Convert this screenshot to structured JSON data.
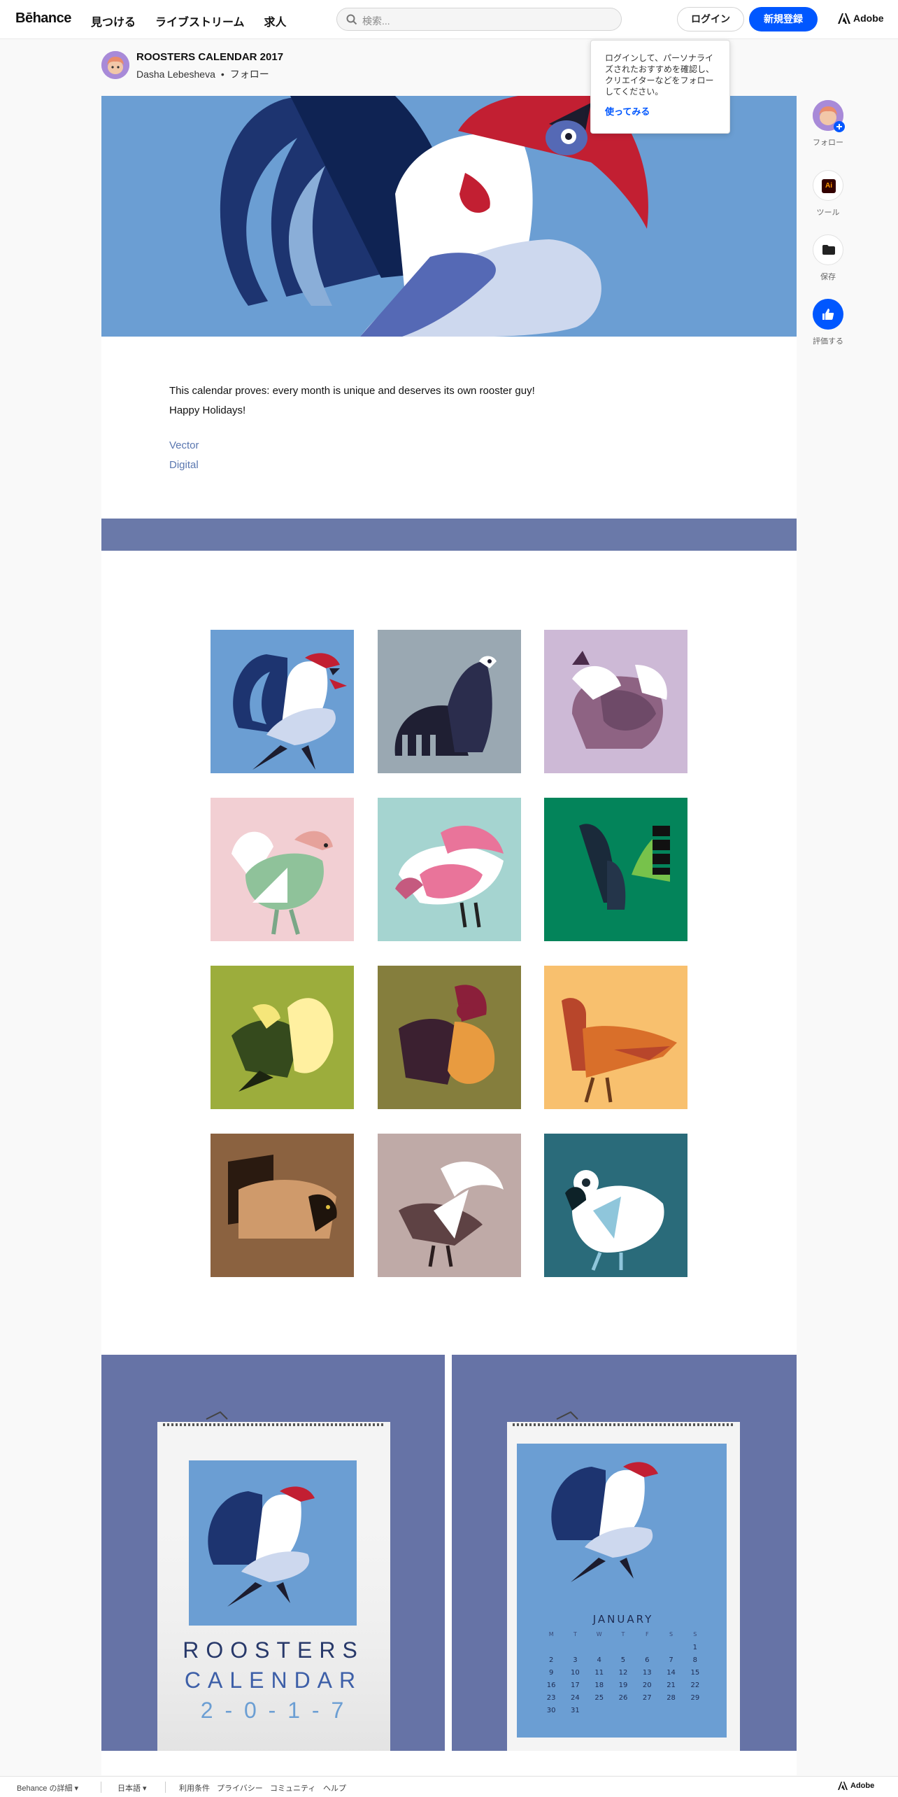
{
  "header": {
    "logo": "Bēhance",
    "nav": [
      "見つける",
      "ライブストリーム",
      "求人"
    ],
    "search_placeholder": "検索...",
    "login": "ログイン",
    "signup": "新規登録",
    "adobe": "Adobe"
  },
  "project": {
    "title": "ROOSTERS CALENDAR 2017",
    "author": "Dasha Lebesheva",
    "follow": "フォロー"
  },
  "tooltip": {
    "text": "ログインして、パーソナライズされたおすすめを確認し、クリエイターなどをフォローしてください。",
    "action": "使ってみる"
  },
  "description": {
    "line1": "This calendar proves: every month is unique and deserves its own rooster guy!",
    "line2": "Happy Holidays!"
  },
  "tags": [
    "Vector",
    "Digital"
  ],
  "rail": {
    "follow": "フォロー",
    "tools": "ツール",
    "tools_badge": "Ai",
    "save": "保存",
    "appreciate": "評価する"
  },
  "calendar_cover": {
    "line1": "ROOSTERS",
    "line2": "CALENDAR",
    "line3": "2 - 0 - 1 - 7"
  },
  "calendar_month": {
    "month": "JANUARY",
    "weekdays": [
      "M",
      "T",
      "W",
      "T",
      "F",
      "S",
      "S"
    ],
    "weeks": [
      [
        "",
        "",
        "",
        "",
        "",
        "",
        "1"
      ],
      [
        "2",
        "3",
        "4",
        "5",
        "6",
        "7",
        "8"
      ],
      [
        "9",
        "10",
        "11",
        "12",
        "13",
        "14",
        "15"
      ],
      [
        "16",
        "17",
        "18",
        "19",
        "20",
        "21",
        "22"
      ],
      [
        "23",
        "24",
        "25",
        "26",
        "27",
        "28",
        "29"
      ],
      [
        "30",
        "31",
        "",
        "",
        "",
        "",
        ""
      ]
    ]
  },
  "footer": {
    "about": "Behance の詳細",
    "language": "日本語",
    "links": [
      "利用条件",
      "プライバシー",
      "コミュニティ",
      "ヘルプ"
    ],
    "adobe": "Adobe"
  },
  "colors": {
    "accent": "#0057ff",
    "hero_bg": "#6b9ed3",
    "band": "#6a79a9",
    "calendar_bg": "#6673a6",
    "tile_backgrounds": [
      "#6b9ed3",
      "#9aa8b2",
      "#cdb9d6",
      "#f2cfd3",
      "#a5d4d0",
      "#03845a",
      "#9cad3c",
      "#857e3d",
      "#f8c06e",
      "#8b6240",
      "#bfaaa7",
      "#2a6b7a"
    ]
  }
}
